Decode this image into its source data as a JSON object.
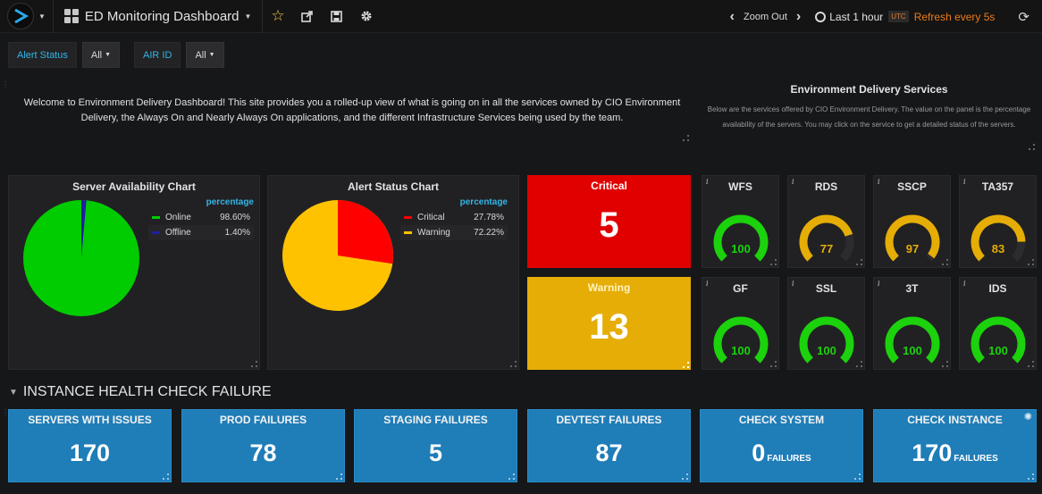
{
  "topbar": {
    "title": "ED Monitoring Dashboard",
    "icons": [
      "app-logo",
      "star-icon",
      "share-icon",
      "save-icon",
      "gear-icon"
    ],
    "zoom_out": "Zoom Out",
    "time_range": "Last 1 hour",
    "timezone": "UTC",
    "refresh": "Refresh every 5s"
  },
  "variables": [
    {
      "label": "Alert Status",
      "value": "All"
    },
    {
      "label": "AIR ID",
      "value": "All"
    }
  ],
  "welcome": {
    "text": "Welcome to Environment Delivery Dashboard! This site provides you a rolled-up view of what is going on in all the services owned by CIO Environment Delivery, the Always On and Nearly Always On applications, and the different Infrastructure Services being used by the team."
  },
  "services": {
    "title": "Environment Delivery Services",
    "desc": "Below are the services offered by CIO Environment Delivery. The value on the panel is the percentage availability of the servers. You may click on the service to get a detailed status of the servers."
  },
  "server_chart": {
    "title": "Server Availability Chart",
    "legend_header": "percentage",
    "items": [
      {
        "name": "Online",
        "value": "98.60%",
        "color": "#00cc00"
      },
      {
        "name": "Offline",
        "value": "1.40%",
        "color": "#1f1fa0"
      }
    ]
  },
  "alert_chart": {
    "title": "Alert Status Chart",
    "legend_header": "percentage",
    "items": [
      {
        "name": "Critical",
        "value": "27.78%",
        "color": "#ff0000"
      },
      {
        "name": "Warning",
        "value": "72.22%",
        "color": "#ffc200"
      }
    ]
  },
  "critical": {
    "title": "Critical",
    "value": "5",
    "color": "#e00000"
  },
  "warning": {
    "title": "Warning",
    "value": "13",
    "color": "#e5ad06"
  },
  "gauges": [
    {
      "name": "WFS",
      "value": 100
    },
    {
      "name": "RDS",
      "value": 77
    },
    {
      "name": "SSCP",
      "value": 97
    },
    {
      "name": "TA357",
      "value": 83
    },
    {
      "name": "GF",
      "value": 100
    },
    {
      "name": "SSL",
      "value": 100
    },
    {
      "name": "3T",
      "value": 100
    },
    {
      "name": "IDS",
      "value": 100
    }
  ],
  "row_title": "INSTANCE HEALTH CHECK FAILURE",
  "health": [
    {
      "title": "SERVERS WITH ISSUES",
      "value": "170",
      "suffix": ""
    },
    {
      "title": "PROD FAILURES",
      "value": "78",
      "suffix": ""
    },
    {
      "title": "STAGING FAILURES",
      "value": "5",
      "suffix": ""
    },
    {
      "title": "DEVTEST FAILURES",
      "value": "87",
      "suffix": ""
    },
    {
      "title": "CHECK SYSTEM",
      "value": "0",
      "suffix": "FAILURES"
    },
    {
      "title": "CHECK INSTANCE",
      "value": "170",
      "suffix": "FAILURES"
    }
  ]
}
